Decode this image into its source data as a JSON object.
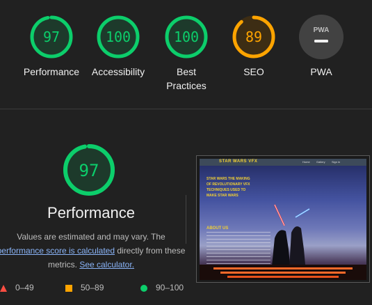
{
  "gauges": [
    {
      "score": "97",
      "label": "Performance",
      "color": "#0cce6b",
      "bg": "#1d3a2b",
      "fraction": 0.97
    },
    {
      "score": "100",
      "label": "Accessibility",
      "color": "#0cce6b",
      "bg": "#1d3a2b",
      "fraction": 1.0
    },
    {
      "score": "100",
      "label_line1": "Best",
      "label_line2": "Practices",
      "color": "#0cce6b",
      "bg": "#1d3a2b",
      "fraction": 1.0
    },
    {
      "score": "89",
      "label": "SEO",
      "color": "#ffa400",
      "bg": "#3d2d14",
      "fraction": 0.89
    },
    {
      "badge": "PWA",
      "label": "PWA",
      "color": "#9e9e9e",
      "bg": "#424242"
    }
  ],
  "main": {
    "score": "97",
    "title": "Performance",
    "desc_line1": "Values are estimated and may vary. The",
    "desc_link1": "performance score is calculated",
    "desc_mid": " directly from these",
    "desc_line3": "metrics. ",
    "desc_link2": "See calculator."
  },
  "legend": [
    {
      "range": "0–49",
      "color": "#ff4e42",
      "shape": "triangle"
    },
    {
      "range": "50–89",
      "color": "#ffa400",
      "shape": "square"
    },
    {
      "range": "90–100",
      "color": "#0cce6b",
      "shape": "circle"
    }
  ],
  "screenshot": {
    "brand": "STAR WARS VFX",
    "nav_links": [
      "Home",
      "Gallery",
      "Sign in"
    ],
    "heading": "STAR WARS THE MAKING OF REVOLUTIONARY VFX TECHNIQUES USED TO MAKE STAR WARS",
    "about": "ABOUT US"
  }
}
